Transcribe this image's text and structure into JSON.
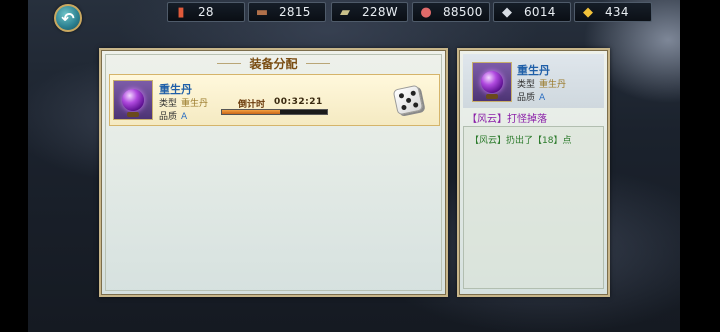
{
  "resources": [
    {
      "icon": "ticket-icon",
      "value": "28"
    },
    {
      "icon": "cannon-icon",
      "value": "2815"
    },
    {
      "icon": "scroll-icon",
      "value": "228W"
    },
    {
      "icon": "meat-icon",
      "value": "88500"
    },
    {
      "icon": "silver-ingot-icon",
      "value": "6014"
    },
    {
      "icon": "gold-ingot-icon",
      "value": "434"
    }
  ],
  "left_panel": {
    "title": "装备分配",
    "item": {
      "name": "重生丹",
      "type_label": "类型",
      "type_value": "重生丹",
      "quality_label": "品质",
      "quality_value": "A",
      "countdown_label": "倒计时",
      "countdown_time": "00:32:21",
      "countdown_progress": 0.55
    }
  },
  "right_panel": {
    "item": {
      "name": "重生丹",
      "type_label": "类型",
      "type_value": "重生丹",
      "quality_label": "品质",
      "quality_value": "A"
    },
    "drop_source": "【风云】打怪掉落",
    "log": "【风云】扔出了【18】点"
  },
  "colors": {
    "panel_border": "#c8b68a",
    "item_name": "#1f5fa8",
    "drop_text": "#8a1fa8",
    "log_text": "#2a7a2a",
    "progress_fill": "#e08a2e"
  }
}
